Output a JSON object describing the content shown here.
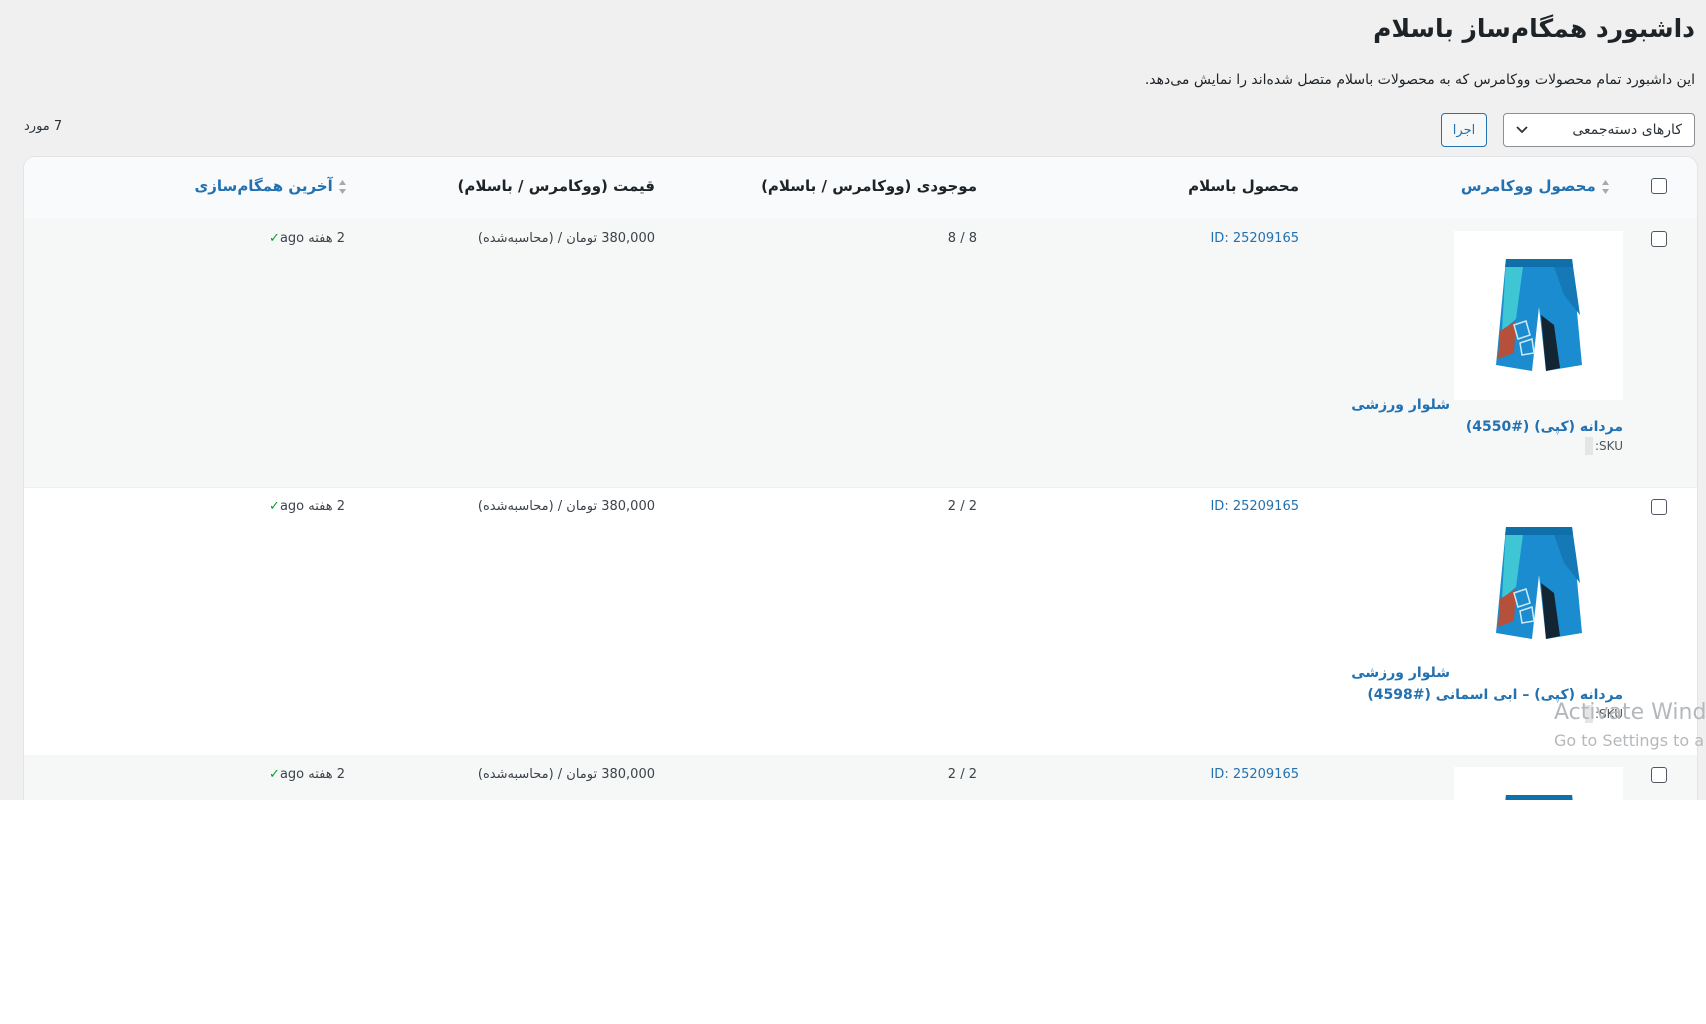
{
  "page": {
    "title": "داشبورد همگام‌ساز باسلام",
    "description": "این داشبورد تمام محصولات ووکامرس که به محصولات باسلام متصل شده‌اند را نمایش می‌دهد."
  },
  "toolbar": {
    "bulk_actions_label": "کارهای دسته‌جمعی",
    "apply_label": "اجرا",
    "item_count": "7 مورد"
  },
  "table": {
    "headers": {
      "woo_product": "محصول ووکامرس",
      "basalam_product": "محصول باسلام",
      "stock": "موجودی (ووکامرس / باسلام)",
      "price": "قیمت (ووکامرس / باسلام)",
      "last_sync": "آخرین همگام‌سازی"
    },
    "rows": [
      {
        "name_line1": "شلوار ورزشی",
        "name_line2": "مردانه (کپی) (#4550)",
        "sku_label": "SKU:",
        "basalam_id": "ID: 25209165",
        "stock": "8 / 8",
        "price": "380,000 تومان / (محاسبه‌شده)",
        "sync_time": "2 هفته ago"
      },
      {
        "name_line1": "شلوار ورزشی",
        "name_line2": "مردانه (کپی) – ابی اسمانی (#4598)",
        "sku_label": "SKU:",
        "basalam_id": "ID: 25209165",
        "stock": "2 / 2",
        "price": "380,000 تومان / (محاسبه‌شده)",
        "sync_time": "2 هفته ago"
      },
      {
        "basalam_id": "ID: 25209165",
        "stock": "2 / 2",
        "price": "380,000 تومان / (محاسبه‌شده)",
        "sync_time": "2 هفته ago"
      }
    ]
  },
  "watermark": {
    "line1": "Activate Wind",
    "line2": "Go to Settings to a"
  },
  "colors": {
    "link": "#2271b1",
    "check": "#00a32a",
    "background": "#f0f0f1"
  }
}
